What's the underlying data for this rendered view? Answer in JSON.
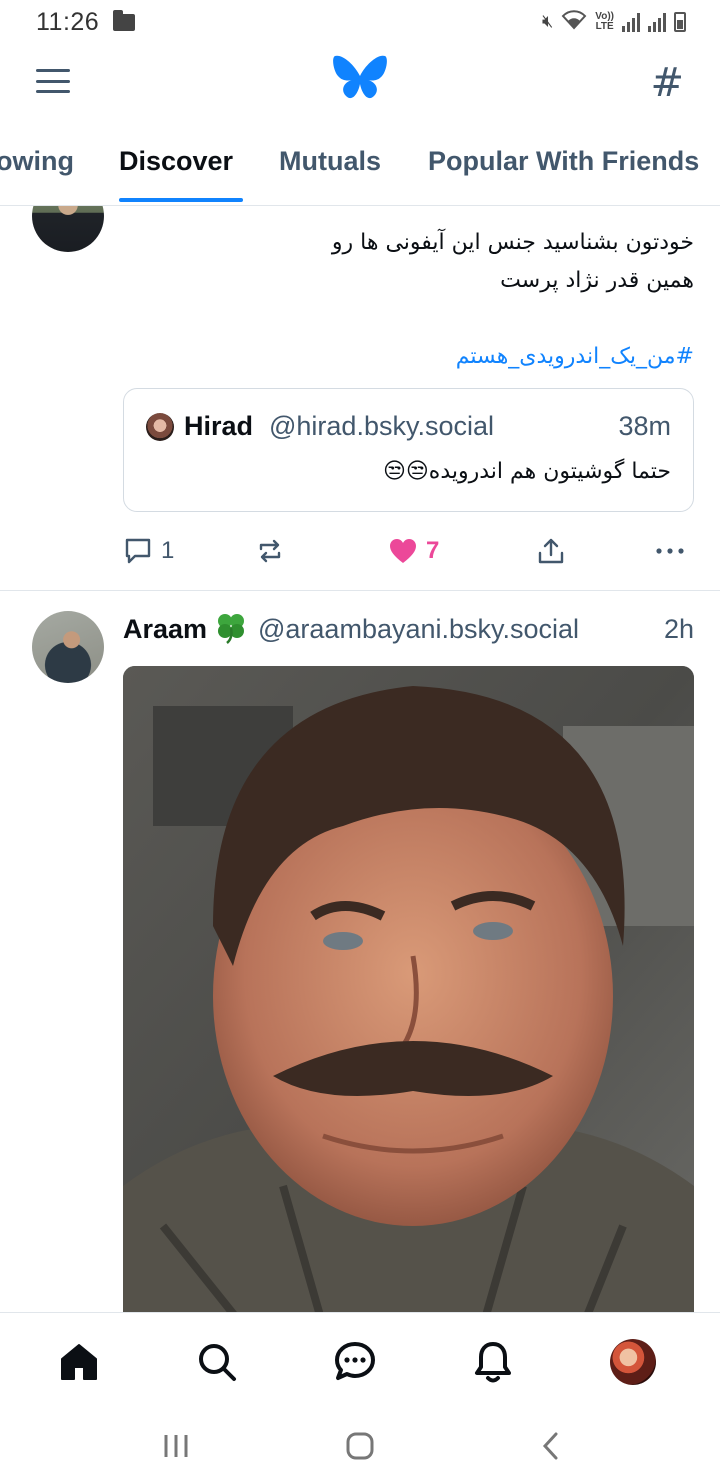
{
  "status_bar": {
    "time": "11:26",
    "lte_label_top": "Vo))",
    "lte_label_bottom": "LTE"
  },
  "header": {
    "menu_icon": "hamburger-menu-icon",
    "logo_icon": "butterfly-logo-icon",
    "feeds_icon": "hash-icon",
    "brand_color": "#1083fe"
  },
  "tabs": [
    {
      "label": "owing",
      "active": false
    },
    {
      "label": "Discover",
      "active": true
    },
    {
      "label": "Mutuals",
      "active": false
    },
    {
      "label": "Popular With Friends",
      "active": false
    }
  ],
  "posts": [
    {
      "text_line1": "خودتون بشناسید جنس این آیفونی ها رو",
      "text_line2": "همین قدر نژاد پرست",
      "hashtag": "#من_یک_اندرویدی_هستم",
      "quote": {
        "name": "Hirad",
        "handle": "@hirad.bsky.social",
        "time": "38m",
        "text": "حتما گوشیتون هم اندرویده😒😒"
      },
      "actions": {
        "replies": "1",
        "likes": "7",
        "liked": true
      }
    },
    {
      "name": "Araam",
      "name_emoji": "clover-icon",
      "handle": "@araambayani.bsky.social",
      "time": "2h"
    }
  ],
  "colors": {
    "like": "#ec4899",
    "fab": "#1a7dfb",
    "secondary_text": "#42576c"
  },
  "bottom_nav": [
    "home-icon",
    "search-icon",
    "chat-icon",
    "bell-icon",
    "profile-avatar"
  ]
}
